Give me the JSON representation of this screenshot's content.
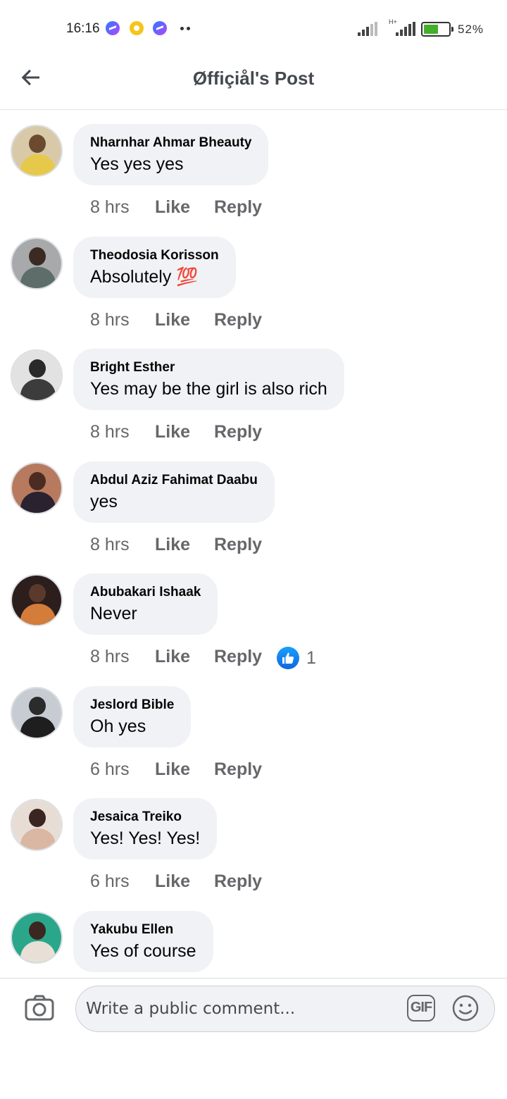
{
  "status_bar": {
    "time": "16:16",
    "notification_icons": [
      "messenger-icon",
      "yellow-app-icon",
      "messenger-icon"
    ],
    "network": "H+",
    "battery": "52%"
  },
  "header": {
    "back_icon": "arrow-left-icon",
    "title": "Øffiçiål's Post"
  },
  "comments": [
    {
      "author": "Nharnhar Ahmar Bheauty",
      "text": "Yes yes yes",
      "time": "8 hrs",
      "like_label": "Like",
      "reply_label": "Reply",
      "avatar_color": "#c9b28a"
    },
    {
      "author": "Theodosia Korisson",
      "text": "Absolutely 💯",
      "time": "8 hrs",
      "like_label": "Like",
      "reply_label": "Reply",
      "avatar_color": "#8c8d8f"
    },
    {
      "author": "Bright Esther",
      "text": "Yes may be the girl is also rich",
      "time": "8 hrs",
      "like_label": "Like",
      "reply_label": "Reply",
      "avatar_color": "#6f6f6f"
    },
    {
      "author": "Abdul Aziz Fahimat Daabu",
      "text": "yes",
      "time": "8 hrs",
      "like_label": "Like",
      "reply_label": "Reply",
      "avatar_color": "#a0624c"
    },
    {
      "author": "Abubakari Ishaak",
      "text": "Never",
      "time": "8 hrs",
      "like_label": "Like",
      "reply_label": "Reply",
      "avatar_color": "#3b2a26",
      "reaction": {
        "icon": "thumbs-up-icon",
        "count": "1"
      }
    },
    {
      "author": "Jeslord Bible",
      "text": "Oh yes",
      "time": "6 hrs",
      "like_label": "Like",
      "reply_label": "Reply",
      "avatar_color": "#5c6470"
    },
    {
      "author": "Jesaica Treiko",
      "text": "Yes! Yes! Yes!",
      "time": "6 hrs",
      "like_label": "Like",
      "reply_label": "Reply",
      "avatar_color": "#d9c1b4"
    },
    {
      "author": "Yakubu Ellen",
      "text": "Yes of course",
      "time": "",
      "like_label": "",
      "reply_label": "",
      "avatar_color": "#2aa78b"
    }
  ],
  "composer": {
    "camera_icon": "camera-icon",
    "placeholder": "Write a public comment...",
    "gif_label": "GIF",
    "emoji_icon": "smiley-icon"
  },
  "colors": {
    "bubble_bg": "#f0f2f5",
    "meta_text": "#65676b",
    "like_blue": "#1877f2"
  }
}
